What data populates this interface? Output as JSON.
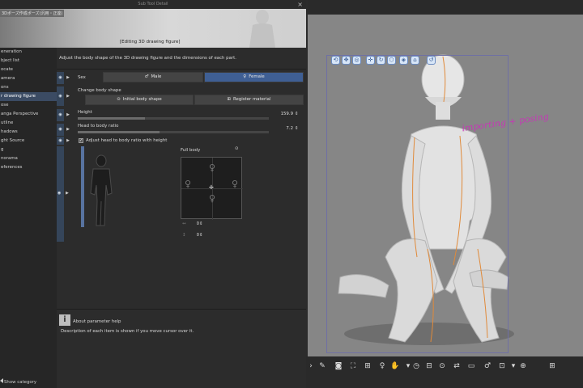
{
  "dialog": {
    "title": "Sub Tool Detail",
    "banner_jp": "3Dポーズ作成ポーズ(汎用・正座)",
    "banner_caption": "[Editing 3D drawing figure]",
    "description": "Adjust the body shape of the 3D drawing figure and the dimensions of each part.",
    "nav_items": [
      "eneration",
      "bject list",
      "ocate",
      "amera",
      "ons",
      "r drawing figure",
      "ose",
      "anga Perspective",
      "utline",
      "hadows",
      "ght Source",
      "g",
      "norama",
      "eferences"
    ],
    "nav_selected_index": 5,
    "show_category": "Show category"
  },
  "sex": {
    "label": "Sex",
    "male": "Male",
    "female": "Female",
    "selected": "Female"
  },
  "body_shape": {
    "label": "Change body shape",
    "initial": "Initial body shape",
    "register": "Register material"
  },
  "height": {
    "label": "Height",
    "value": "159.9",
    "fraction": 0.35
  },
  "head_ratio": {
    "label": "Head to body ratio",
    "value": "7.2",
    "fraction": 0.43
  },
  "adjust": {
    "label": "Adjust head to body ratio with height",
    "checked": true
  },
  "full_body": {
    "label": "Full body"
  },
  "xy": {
    "x_value": "0",
    "y_value": "0"
  },
  "help": {
    "title": "About parameter help",
    "text": "Description of each item is shown if you move cursor over it."
  },
  "annotation": "importing + posing",
  "colors": {
    "accent": "#3f5f94",
    "selected_nav": "#3b4b63",
    "annotation": "#c637b6",
    "viewport": "#868686"
  }
}
